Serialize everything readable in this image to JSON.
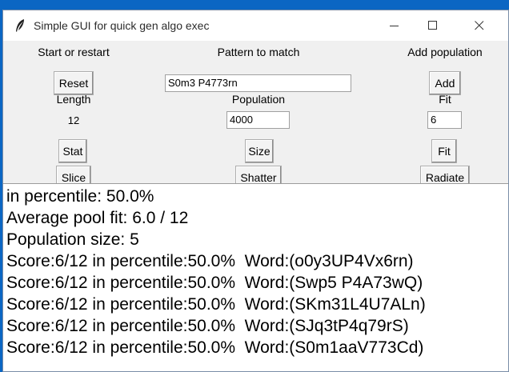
{
  "window": {
    "title": "Simple GUI for quick gen algo exec"
  },
  "form": {
    "start_label": "Start or restart",
    "reset_button": "Reset",
    "pattern_label": "Pattern to match",
    "pattern_value": "S0m3 P4773rn",
    "add_population_label": "Add population",
    "add_button": "Add",
    "length_label": "Length",
    "length_value": "12",
    "population_label": "Population",
    "population_value": "4000",
    "fit_label": "Fit",
    "fit_value": "6",
    "stat_button": "Stat",
    "size_button": "Size",
    "fit_button": "Fit",
    "slice_button": "Slice",
    "shatter_button": "Shatter",
    "radiate_button": "Radiate"
  },
  "output": {
    "lines": [
      "in percentile: 50.0%",
      "Average pool fit: 6.0 / 12",
      "Population size: 5",
      "Score:6/12 in percentile:50.0%  Word:(o0y3UP4Vx6rn)",
      "Score:6/12 in percentile:50.0%  Word:(Swp5 P4A73wQ)",
      "Score:6/12 in percentile:50.0%  Word:(SKm31L4U7ALn)",
      "Score:6/12 in percentile:50.0%  Word:(SJq3tP4q79rS)",
      "Score:6/12 in percentile:50.0%  Word:(S0m1aaV773Cd)"
    ]
  },
  "icons": {
    "app": "feather-icon",
    "minimize": "minimize-icon",
    "maximize": "maximize-icon",
    "close": "close-icon"
  },
  "colors": {
    "desktop": "#0b66c3",
    "window_bg": "#f0f0f0",
    "output_bg": "#ffffff"
  }
}
